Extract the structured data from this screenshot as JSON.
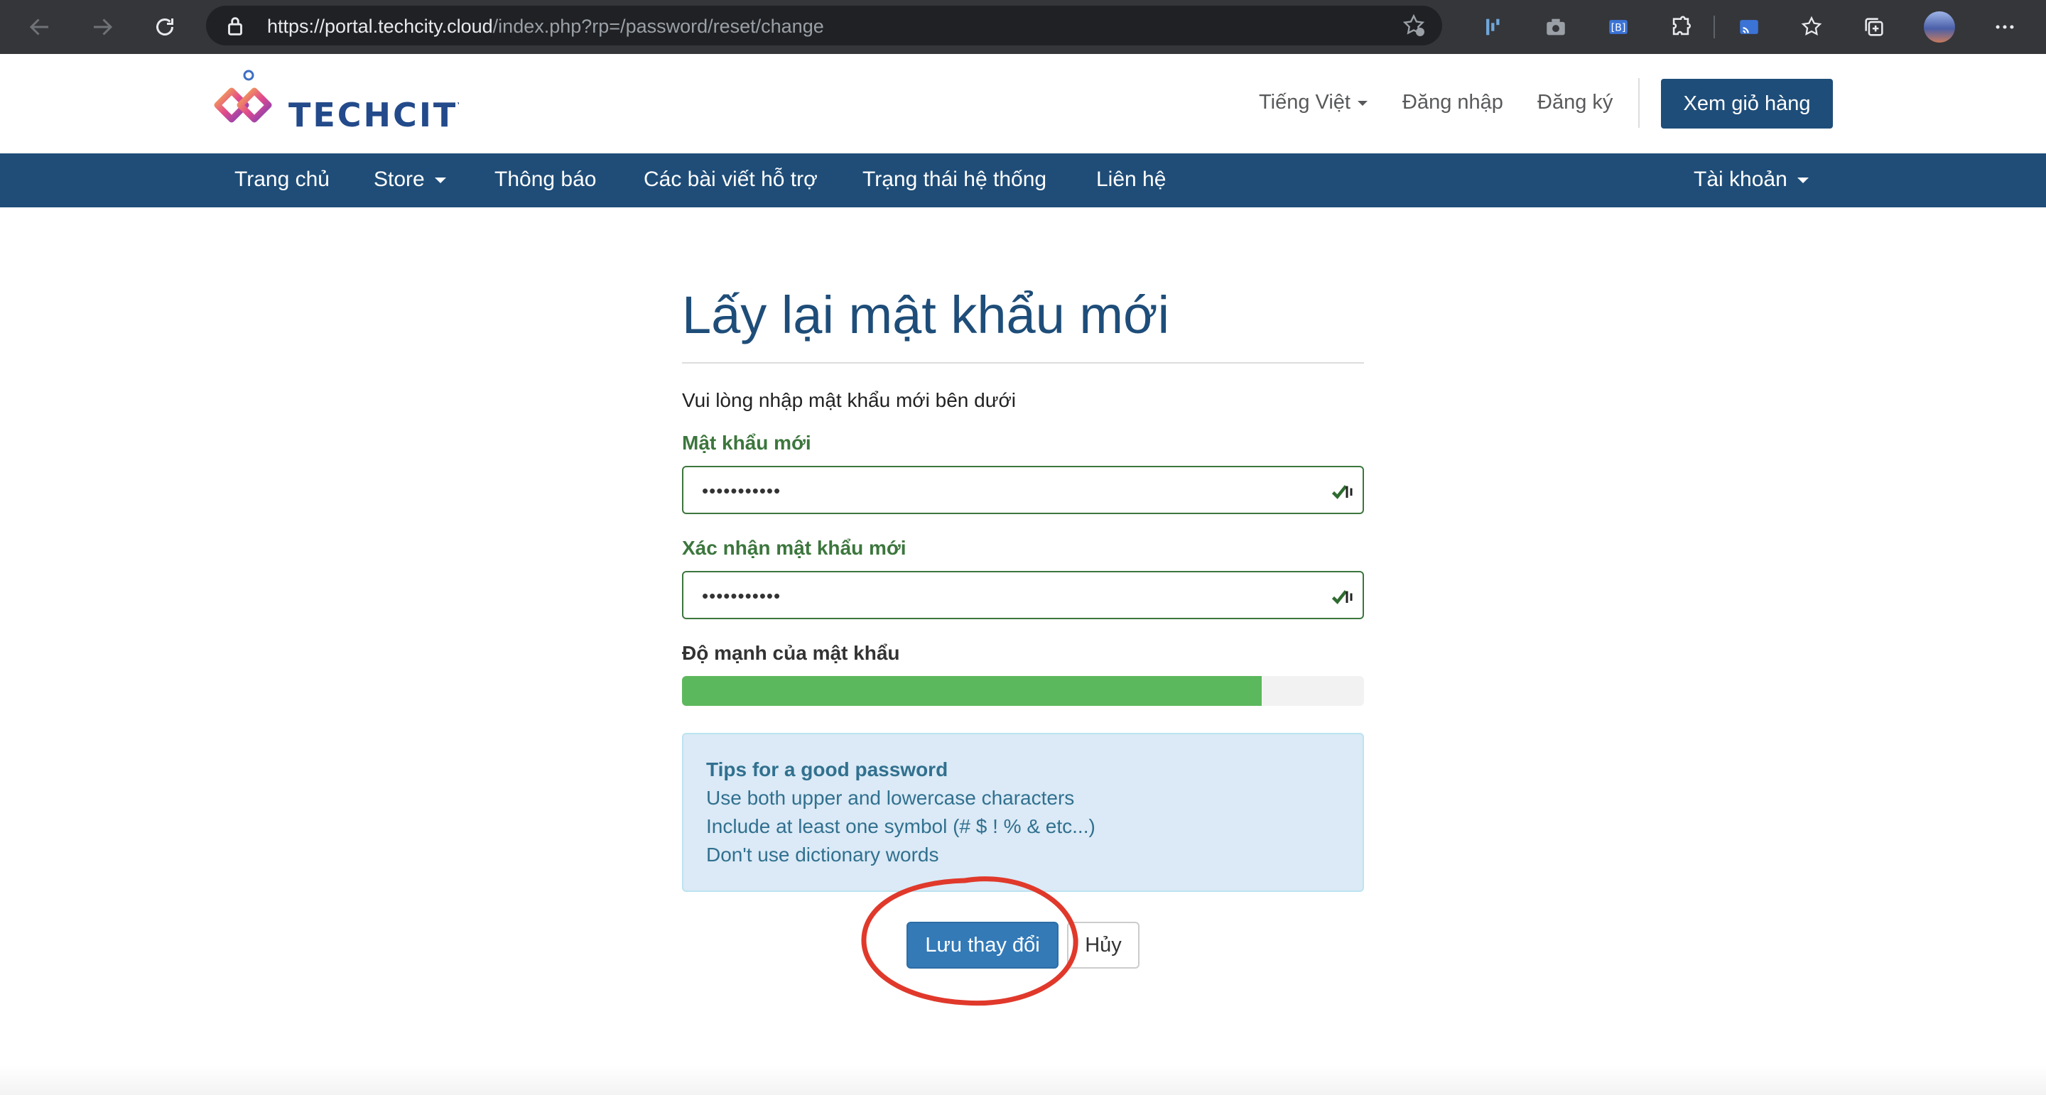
{
  "browser": {
    "url_host": "https://portal.techcity.cloud",
    "url_path": "/index.php?rp=/password/reset/change",
    "icons": [
      "back-icon",
      "forward-icon",
      "reload-icon",
      "lock-icon",
      "add-favorite-icon",
      "extension-icon",
      "camera-icon",
      "extension-icon",
      "puzzle-icon",
      "cast-icon",
      "favorites-icon",
      "collections-icon",
      "profile-avatar",
      "more-icon"
    ]
  },
  "header": {
    "logo_text": "TECHCITY",
    "language": "Tiếng Việt",
    "login": "Đăng nhập",
    "register": "Đăng ký",
    "cart": "Xem giỏ hàng"
  },
  "nav": {
    "items": [
      {
        "label": "Trang chủ"
      },
      {
        "label": "Store"
      },
      {
        "label": "Thông báo"
      },
      {
        "label": "Các bài viết hỗ trợ"
      },
      {
        "label": "Trạng thái hệ thống"
      },
      {
        "label": "Liên hệ"
      }
    ],
    "account": "Tài khoản"
  },
  "form": {
    "title": "Lấy lại mật khẩu mới",
    "subtitle": "Vui lòng nhập mật khẩu mới bên dưới",
    "new_password_label": "Mật khẩu mới",
    "new_password_value": "•••••••••••",
    "confirm_password_label": "Xác nhận mật khẩu mới",
    "confirm_password_value": "•••••••••••",
    "strength_label": "Độ mạnh của mật khẩu",
    "strength_percent": 85,
    "tips": {
      "title": "Tips for a good password",
      "lines": [
        "Use both upper and lowercase characters",
        "Include at least one symbol (# $ ! % & etc...)",
        "Don't use dictionary words"
      ]
    },
    "save_button": "Lưu thay đổi",
    "cancel_button": "Hủy"
  },
  "colors": {
    "brand_blue": "#1f4d78",
    "success_green": "#3c763d",
    "progress_green": "#5cb85c",
    "annotation_red": "#e0392b"
  }
}
